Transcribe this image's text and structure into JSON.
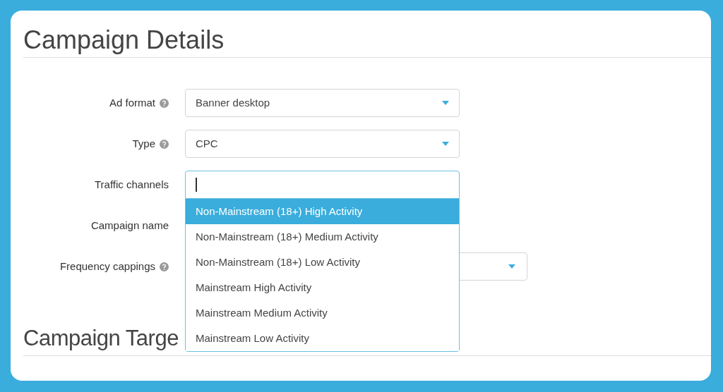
{
  "sections": [
    {
      "title": "Campaign Details"
    },
    {
      "title": "Campaign Targe"
    }
  ],
  "fields": [
    {
      "kind": "select",
      "label": "Ad format",
      "help": true,
      "value": "Banner desktop"
    },
    {
      "kind": "select",
      "label": "Type",
      "help": true,
      "value": "CPC"
    },
    {
      "kind": "multiselect",
      "label": "Traffic channels",
      "help": false,
      "expanded": true,
      "options": [
        {
          "label": "Non-Mainstream (18+) High Activity",
          "selected": true
        },
        {
          "label": "Non-Mainstream (18+) Medium Activity",
          "selected": false
        },
        {
          "label": "Non-Mainstream (18+) Low Activity",
          "selected": false
        },
        {
          "label": "Mainstream High Activity",
          "selected": false
        },
        {
          "label": "Mainstream Medium Activity",
          "selected": false
        },
        {
          "label": "Mainstream Low Activity",
          "selected": false
        }
      ]
    },
    {
      "kind": "hidden",
      "label": "Campaign name",
      "help": false
    },
    {
      "kind": "wideselect",
      "label": "Frequency cappings",
      "help": true
    }
  ]
}
